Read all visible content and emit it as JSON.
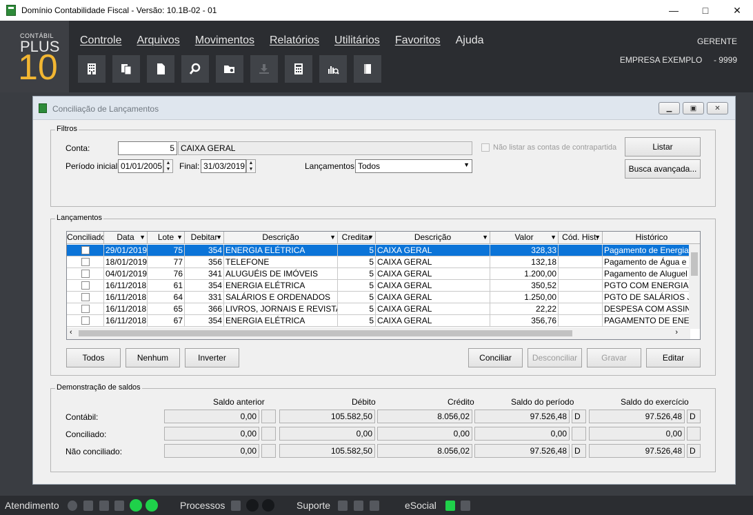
{
  "window": {
    "title": "Domínio Contabilidade Fiscal  - Versão: 10.1B-02 - 01"
  },
  "logo": {
    "line1": "CONTÁBIL",
    "line2": "PLUS",
    "line3": "10"
  },
  "menu": [
    {
      "label": "Controle"
    },
    {
      "label": "Arquivos"
    },
    {
      "label": "Movimentos"
    },
    {
      "label": "Relatórios"
    },
    {
      "label": "Utilitários"
    },
    {
      "label": "Favoritos"
    },
    {
      "label": "Ajuda"
    }
  ],
  "toolbar_icons": [
    "building-icon",
    "documents-icon",
    "document-icon",
    "search-icon",
    "folder-search-icon",
    "download-icon",
    "calculator-icon",
    "chart-search-icon",
    "book-icon"
  ],
  "header": {
    "user": "GERENTE",
    "company": "EMPRESA EXEMPLO",
    "company_code": "- 9999"
  },
  "dialog": {
    "title": "Conciliação de Lançamentos",
    "filtros": {
      "legend": "Filtros",
      "conta_label": "Conta:",
      "conta_value": "5",
      "conta_desc": "CAIXA GERAL",
      "nao_listar_label": "Não listar as contas de contrapartida",
      "periodo_label": "Período inicial:",
      "periodo_inicial": "01/01/2005",
      "final_label": "Final:",
      "periodo_final": "31/03/2019",
      "lancamentos_label": "Lançamentos:",
      "lancamentos_value": "Todos",
      "listar_button": "Listar",
      "busca_button": "Busca avançada..."
    },
    "lancamentos": {
      "legend": "Lançamentos",
      "columns": [
        "Conciliado",
        "Data",
        "Lote",
        "Debitar",
        "Descrição",
        "Creditar",
        "Descrição",
        "Valor",
        "Cód. Hist.",
        "Histórico"
      ],
      "rows": [
        {
          "data": "29/01/2019",
          "lote": "75",
          "debitar": "354",
          "desc_deb": "ENERGIA ELÉTRICA",
          "creditar": "5",
          "desc_cred": "CAIXA GERAL",
          "valor": "328,33",
          "cod_hist": "",
          "historico": "Pagamento de Energia Elé"
        },
        {
          "data": "18/01/2019",
          "lote": "77",
          "debitar": "356",
          "desc_deb": "TELEFONE",
          "creditar": "5",
          "desc_cred": "CAIXA GERAL",
          "valor": "132,18",
          "cod_hist": "",
          "historico": "Pagamento de Água e Esg"
        },
        {
          "data": "04/01/2019",
          "lote": "76",
          "debitar": "341",
          "desc_deb": "ALUGUÉIS DE IMÓVEIS",
          "creditar": "5",
          "desc_cred": "CAIXA GERAL",
          "valor": "1.200,00",
          "cod_hist": "",
          "historico": "Pagamento de Aluguel ref"
        },
        {
          "data": "16/11/2018",
          "lote": "61",
          "debitar": "354",
          "desc_deb": "ENERGIA ELÉTRICA",
          "creditar": "5",
          "desc_cred": "CAIXA GERAL",
          "valor": "350,52",
          "cod_hist": "",
          "historico": "PGTO COM ENERGIA EL"
        },
        {
          "data": "16/11/2018",
          "lote": "64",
          "debitar": "331",
          "desc_deb": "SALÁRIOS E ORDENADOS",
          "creditar": "5",
          "desc_cred": "CAIXA GERAL",
          "valor": "1.250,00",
          "cod_hist": "",
          "historico": "PGTO DE SALÁRIOS JOÃ"
        },
        {
          "data": "16/11/2018",
          "lote": "65",
          "debitar": "366",
          "desc_deb": "LIVROS, JORNAIS E REVISTAS",
          "creditar": "5",
          "desc_cred": "CAIXA GERAL",
          "valor": "22,22",
          "cod_hist": "",
          "historico": "DESPESA COM ASSINAT"
        },
        {
          "data": "16/11/2018",
          "lote": "67",
          "debitar": "354",
          "desc_deb": "ENERGIA ELÉTRICA",
          "creditar": "5",
          "desc_cred": "CAIXA GERAL",
          "valor": "356,76",
          "cod_hist": "",
          "historico": "PAGAMENTO DE ENERG"
        }
      ],
      "buttons": {
        "todos": "Todos",
        "nenhum": "Nenhum",
        "inverter": "Inverter",
        "conciliar": "Conciliar",
        "desconciliar": "Desconciliar",
        "gravar": "Gravar",
        "editar": "Editar"
      }
    },
    "saldos": {
      "legend": "Demonstração de saldos",
      "headers": {
        "anterior": "Saldo anterior",
        "debito": "Débito",
        "credito": "Crédito",
        "periodo": "Saldo do período",
        "exercicio": "Saldo do exercício"
      },
      "rows": [
        {
          "label": "Contábil:",
          "anterior": "0,00",
          "anterior_dc": "",
          "debito": "105.582,50",
          "credito": "8.056,02",
          "periodo": "97.526,48",
          "periodo_dc": "D",
          "exercicio": "97.526,48",
          "exercicio_dc": "D"
        },
        {
          "label": "Conciliado:",
          "anterior": "0,00",
          "anterior_dc": "",
          "debito": "0,00",
          "credito": "0,00",
          "periodo": "0,00",
          "periodo_dc": "",
          "exercicio": "0,00",
          "exercicio_dc": ""
        },
        {
          "label": "Não conciliado:",
          "anterior": "0,00",
          "anterior_dc": "",
          "debito": "105.582,50",
          "credito": "8.056,02",
          "periodo": "97.526,48",
          "periodo_dc": "D",
          "exercicio": "97.526,48",
          "exercicio_dc": "D"
        }
      ]
    }
  },
  "statusbar": {
    "atendimento": "Atendimento",
    "processos": "Processos",
    "suporte": "Suporte",
    "esocial": "eSocial"
  },
  "colors": {
    "accent_logo": "#f2b632",
    "selection": "#0b74d8",
    "status_green": "#1fd14a"
  }
}
